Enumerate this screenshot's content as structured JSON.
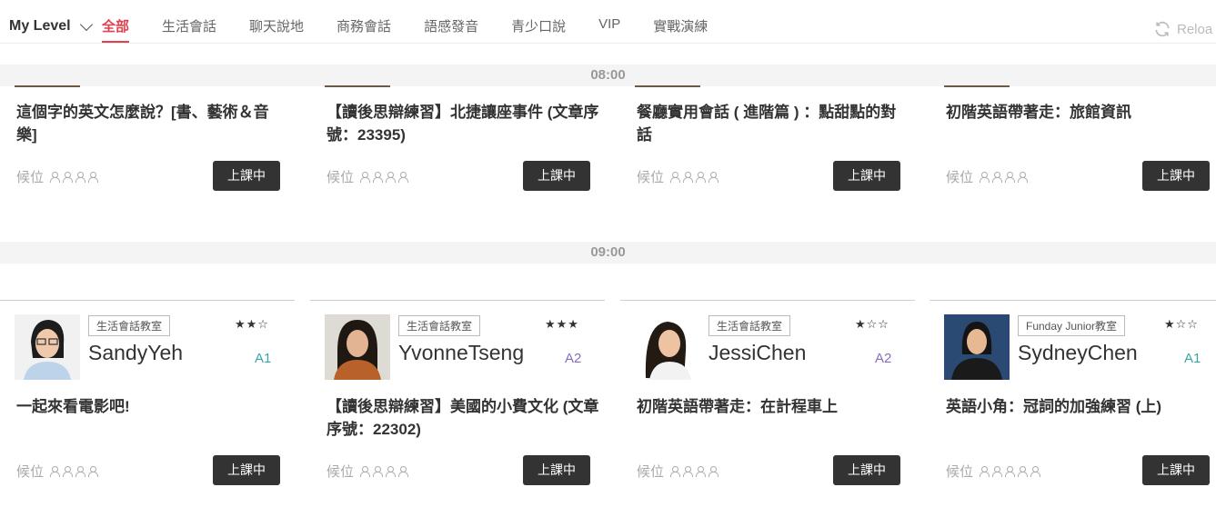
{
  "nav": {
    "level_label": "My Level",
    "tabs": [
      "全部",
      "生活會話",
      "聊天說地",
      "商務會話",
      "語感發音",
      "青少口說",
      "VIP",
      "實戰演練"
    ],
    "active_tab": 0,
    "reload_label": "Reloa"
  },
  "button_label": "上課中",
  "waitlist_label": "候位",
  "slots": [
    {
      "time": "08:00",
      "cards": [
        {
          "title": "這個字的英文怎麼說？[書、藝術＆音樂]",
          "waitlist_count": 4
        },
        {
          "title": "【讀後思辯練習】北捷讓座事件 (文章序號：23395)",
          "waitlist_count": 4
        },
        {
          "title": "餐廳實用會話 ( 進階篇 ) ：點甜點的對話",
          "waitlist_count": 4
        },
        {
          "title": "初階英語帶著走：旅館資訊",
          "waitlist_count": 4
        }
      ]
    },
    {
      "time": "09:00",
      "cards": [
        {
          "room": "生活會話教室",
          "stars": "★★☆",
          "teacher": "SandyYeh",
          "level": "A1",
          "title": "一起來看電影吧!",
          "waitlist_count": 4
        },
        {
          "room": "生活會話教室",
          "stars": "★★★",
          "teacher": "YvonneTseng",
          "level": "A2",
          "title": "【讀後思辯練習】美國的小費文化 (文章序號：22302)",
          "waitlist_count": 4
        },
        {
          "room": "生活會話教室",
          "stars": "★☆☆",
          "teacher": "JessiChen",
          "level": "A2",
          "title": "初階英語帶著走：在計程車上",
          "waitlist_count": 4
        },
        {
          "room": "Funday Junior教室",
          "stars": "★☆☆",
          "teacher": "SydneyChen",
          "level": "A1",
          "title": "英語小角：冠詞的加強練習 (上)",
          "waitlist_count": 5
        }
      ]
    }
  ],
  "colors": {
    "accent": "#e0404f",
    "level_A1": "#3aa6a6",
    "level_A2": "#8a6bbf",
    "button_bg": "#333333"
  },
  "icons": {
    "reload": "reload-icon",
    "waitlist": "person-icon",
    "dropdown": "chevron-down-icon"
  }
}
